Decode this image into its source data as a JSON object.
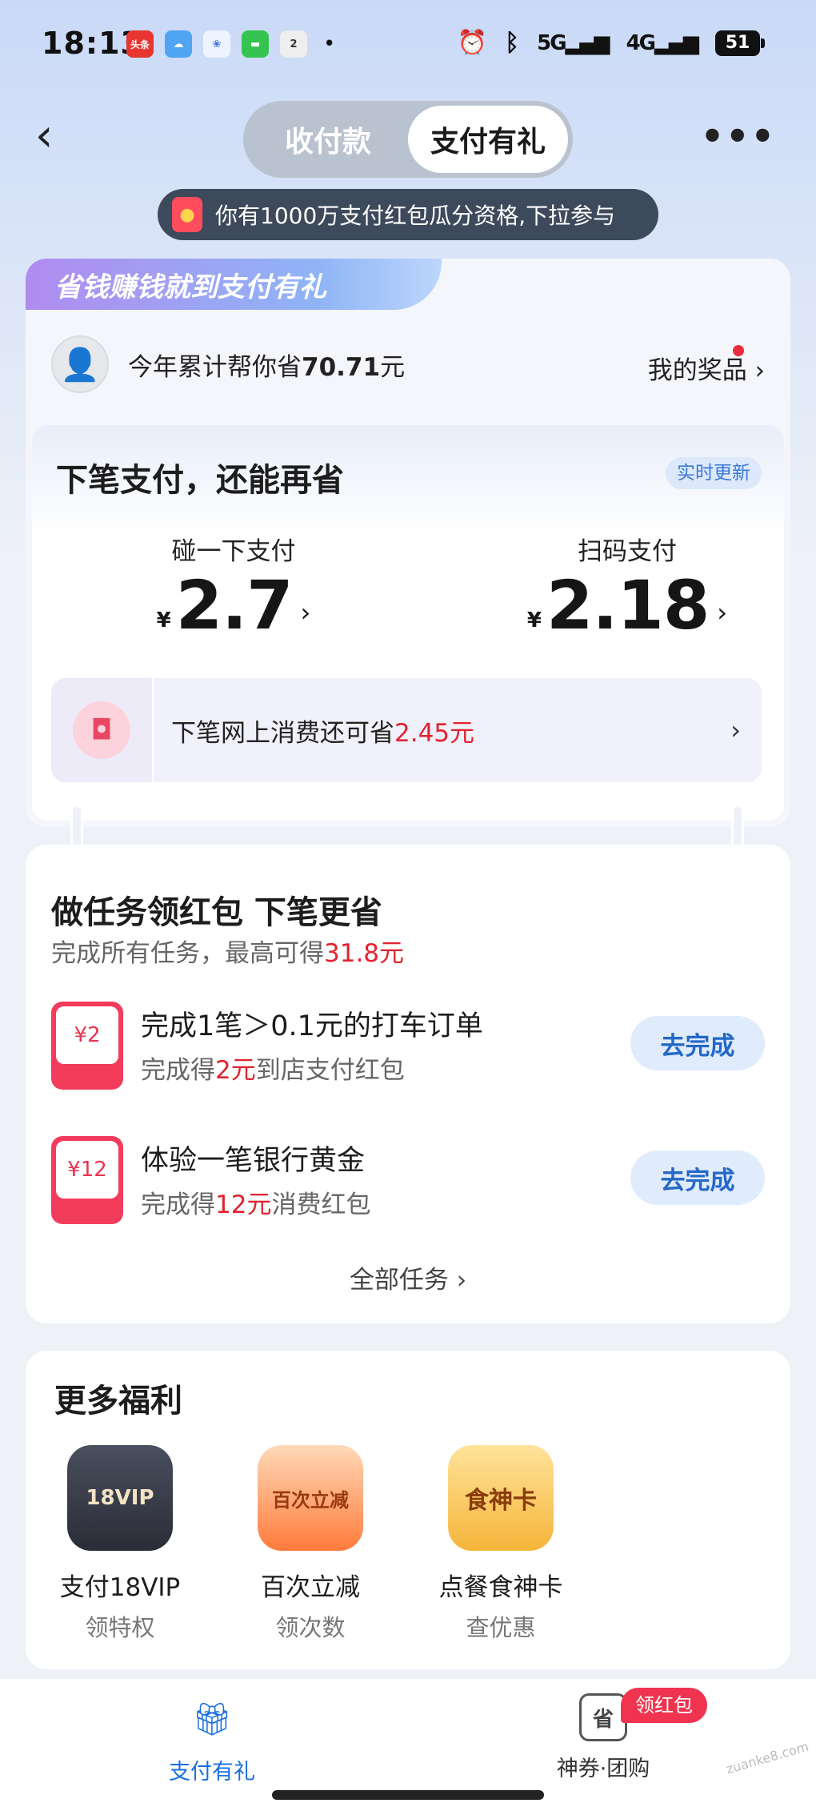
{
  "status_bar": {
    "time": "18:13",
    "apps": [
      {
        "icon": "toutiao-app-icon",
        "label": "头条",
        "color": "#e8352f"
      },
      {
        "icon": "weather-app-icon",
        "label": "",
        "color": "#4fa5f2"
      },
      {
        "icon": "drive-app-icon",
        "label": "",
        "color": "#3c78e6"
      },
      {
        "icon": "messages-app-icon",
        "label": "",
        "color": "#35c451"
      },
      {
        "icon": "badge-app-icon",
        "label": "2",
        "color": "#eeeeee"
      }
    ],
    "dot": "•",
    "signal_5g": "5G",
    "signal_4g": "4G",
    "battery": "51"
  },
  "header": {
    "tabs": [
      {
        "label": "收付款",
        "active": false
      },
      {
        "label": "支付有礼",
        "active": true
      }
    ],
    "notice": "你有1000万支付红包瓜分资格,下拉参与"
  },
  "savings": {
    "ribbon": "省钱赚钱就到支付有礼",
    "saved_prefix": "今年累计帮你省",
    "saved_amount": "70.71",
    "saved_suffix": "元",
    "prize_label": "我的奖品",
    "next_title": "下笔支付，还能再省",
    "live_tag": "实时更新",
    "currency": "¥",
    "tap_label": "碰一下支付",
    "tap_value": "2.7",
    "scan_label": "扫码支付",
    "scan_value": "2.18",
    "online_prefix": "下笔网上消费还可省",
    "online_amount": "2.45元"
  },
  "tasks": {
    "title": "做任务领红包 下笔更省",
    "sub_prefix": "完成所有任务，最高可得",
    "sub_amount": "31.8元",
    "items": [
      {
        "coupon": "¥2",
        "title": "完成1笔＞0.1元的打车订单",
        "sub_prefix": "完成得",
        "sub_amount": "2元",
        "sub_suffix": "到店支付红包",
        "button": "去完成"
      },
      {
        "coupon": "¥12",
        "title": "体验一笔银行黄金",
        "sub_prefix": "完成得",
        "sub_amount": "12元",
        "sub_suffix": "消费红包",
        "button": "去完成"
      }
    ],
    "all_label": "全部任务 ›"
  },
  "benefits": {
    "title": "更多福利",
    "items": [
      {
        "icon_text": "18VIP",
        "title": "支付18VIP",
        "sub": "领特权"
      },
      {
        "icon_text": "百次立减",
        "title": "百次立减",
        "sub": "领次数"
      },
      {
        "icon_text": "食神卡",
        "title": "点餐食神卡",
        "sub": "查优惠"
      }
    ]
  },
  "tabbar": {
    "tab1": "支付有礼",
    "tab2": "神券·团购",
    "badge": "领红包",
    "active_color": "#1a6fe0"
  },
  "watermark": "zuanke8.com"
}
